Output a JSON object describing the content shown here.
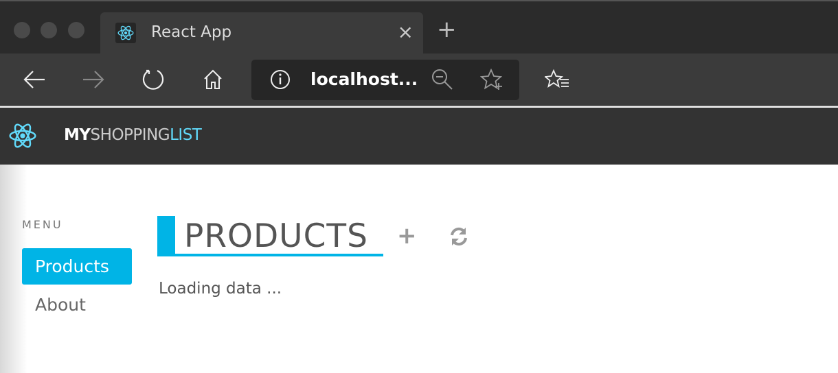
{
  "browser": {
    "tab_title": "React App",
    "tab_close": "×",
    "new_tab": "+",
    "address": "localhost..."
  },
  "app": {
    "brand": {
      "part1": "MY",
      "part2": "SHOPPING",
      "part3": "LIST"
    },
    "menu_label": "MENU",
    "menu": [
      {
        "label": "Products",
        "active": true
      },
      {
        "label": "About",
        "active": false
      }
    ],
    "page_title": "PRODUCTS",
    "add_label": "+",
    "loading_text": "Loading data ..."
  },
  "colors": {
    "accent": "#00b4e6",
    "react": "#61dafb",
    "chrome_dark": "#2b2b2b"
  }
}
